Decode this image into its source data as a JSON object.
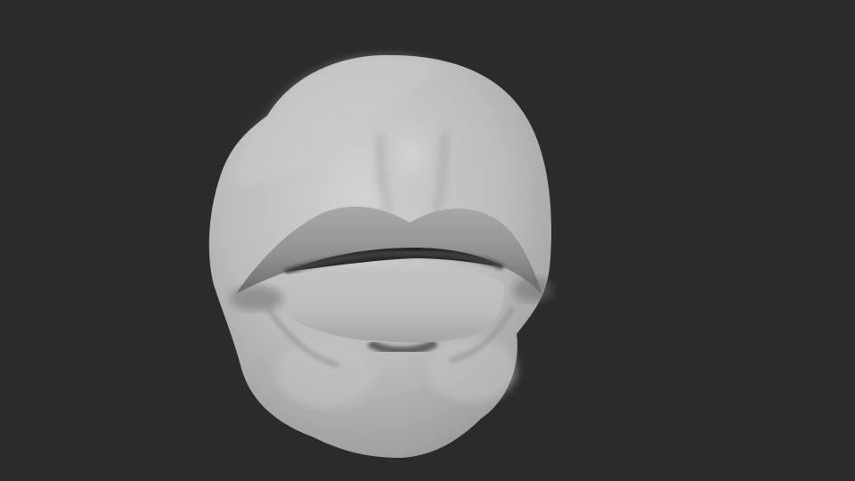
{
  "viewport": {
    "background_color": "#2b2b2b",
    "subject": "sculpted-mouth-mesh",
    "mesh_color": "#b9b9b9",
    "shadow_color": "#3a3a3a"
  }
}
